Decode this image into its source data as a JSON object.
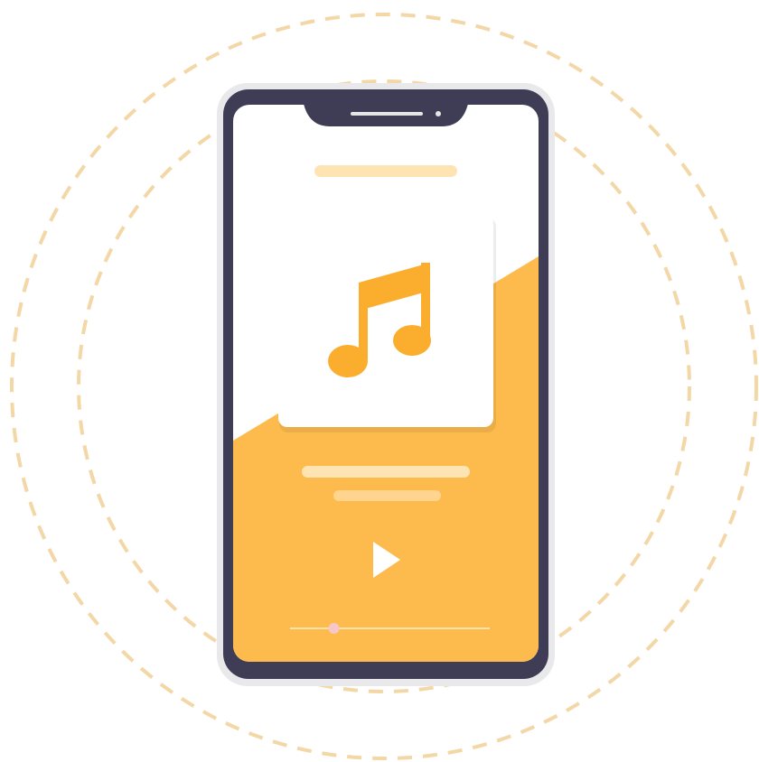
{
  "illustration": {
    "subject": "music-player-phone",
    "icons": [
      "music-note-icon",
      "play-icon"
    ],
    "playback": {
      "progress": 0.22
    }
  },
  "colors": {
    "background": "#ffffff",
    "phone_frame": "#3f3d56",
    "phone_shadow": "#e9e9ec",
    "screen_top": "#ffffff",
    "accent": "#fdbb4e",
    "accent_dark": "#fbae2e",
    "placeholder_light": "#fee4b3",
    "placeholder_mid": "#fed48f",
    "dashed_ring": "#f3d7a7",
    "slider_track": "#ffe2ad",
    "slider_thumb": "#f7c6c9",
    "play_icon": "#ffffff"
  }
}
